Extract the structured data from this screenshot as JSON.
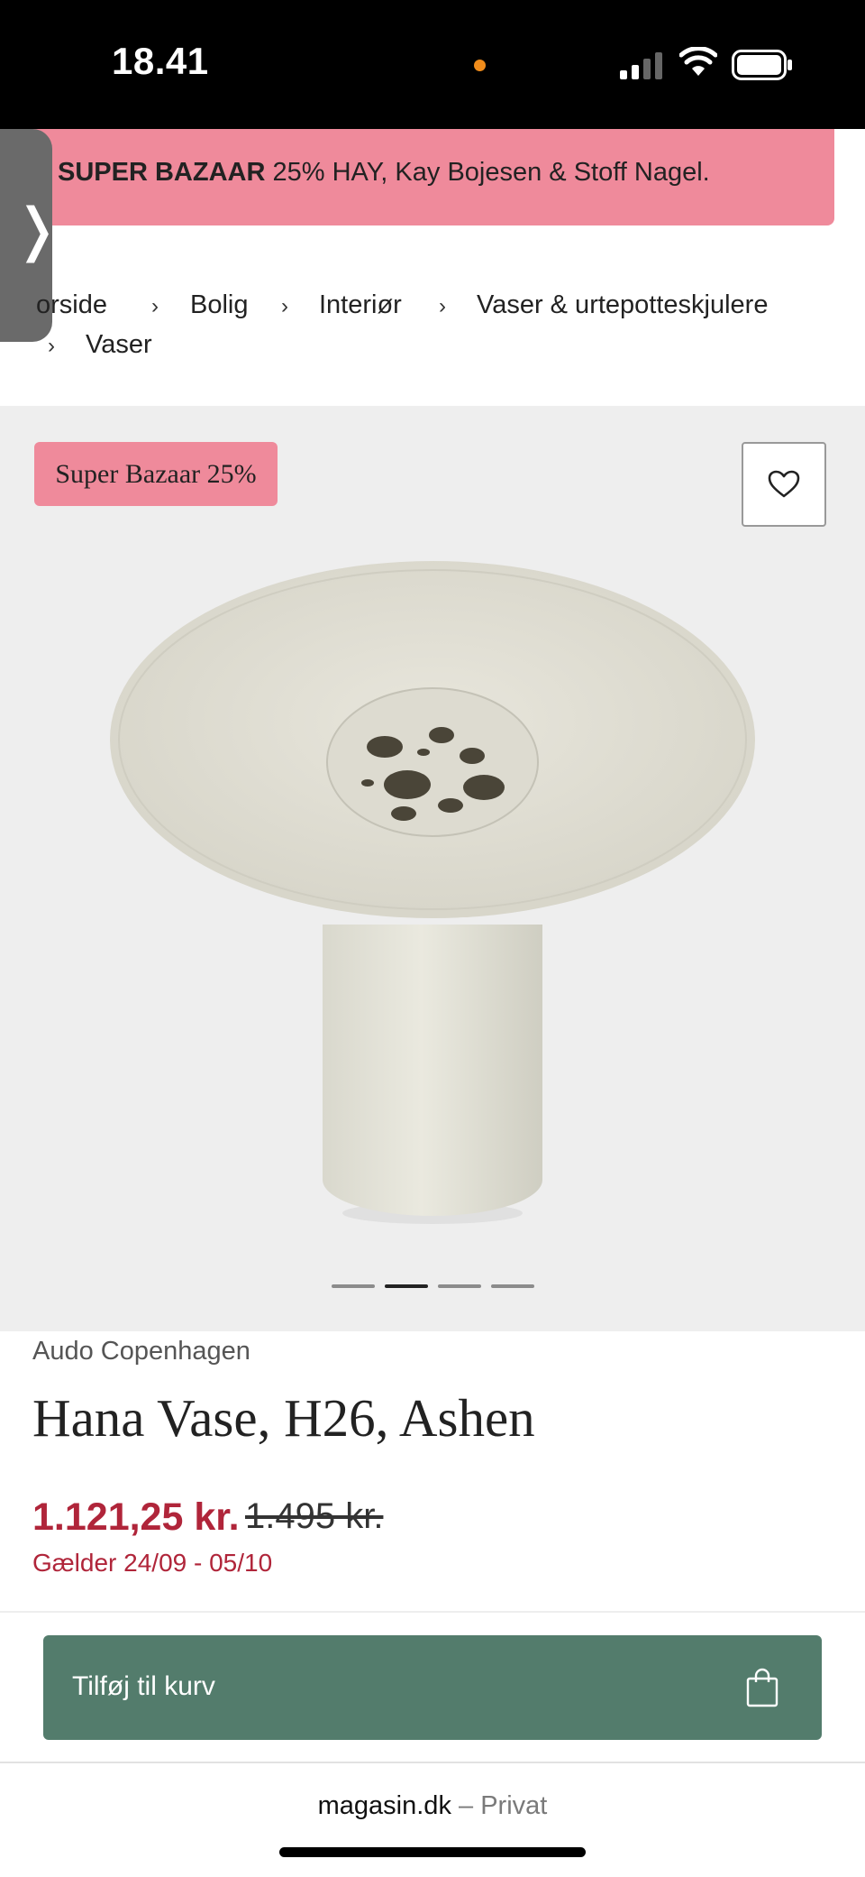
{
  "status_bar": {
    "time": "18.41"
  },
  "promo_banner": {
    "bold": "SUPER BAZAAR",
    "text": " 25% HAY, Kay Bojesen & Stoff Nagel."
  },
  "side_tab": {
    "glyph": "❭"
  },
  "breadcrumb": {
    "items": [
      "orside",
      "Bolig",
      "Interiør",
      "Vaser & urtepotteskjulere",
      "Vaser"
    ],
    "separator": "›"
  },
  "gallery": {
    "sale_badge": "Super Bazaar 25%",
    "favorite_icon": "heart-icon",
    "slide_count": 4,
    "active_slide": 2
  },
  "product": {
    "brand": "Audo Copenhagen",
    "title": "Hana Vase, H26, Ashen",
    "price": "1.121,25 kr.",
    "old_price": "1.495 kr.",
    "valid": "Gælder 24/09 - 05/10"
  },
  "cart": {
    "label": "Tilføj til kurv",
    "icon": "shopping-bag-icon"
  },
  "browser": {
    "domain": "magasin.dk",
    "dash": " – ",
    "mode": "Privat"
  },
  "colors": {
    "banner": "#ef8a9b",
    "price": "#b0253a",
    "cart_button": "#537c6c"
  }
}
